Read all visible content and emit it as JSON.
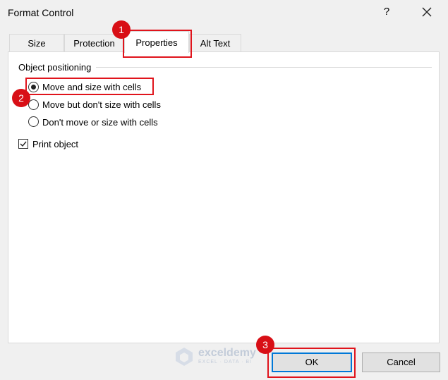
{
  "window": {
    "title": "Format Control",
    "help_glyph": "?",
    "close_icon": "close-x-icon"
  },
  "tabs": [
    {
      "label": "Size",
      "active": false
    },
    {
      "label": "Protection",
      "active": false
    },
    {
      "label": "Properties",
      "active": true
    },
    {
      "label": "Alt Text",
      "active": false
    }
  ],
  "object_positioning": {
    "heading": "Object positioning",
    "options": [
      {
        "label": "Move and size with cells",
        "selected": true
      },
      {
        "label": "Move but don't size with cells",
        "selected": false
      },
      {
        "label": "Don't move or size with cells",
        "selected": false
      }
    ]
  },
  "print_object": {
    "label": "Print object",
    "checked": true
  },
  "buttons": {
    "ok": "OK",
    "cancel": "Cancel"
  },
  "annotations": {
    "step1": "1",
    "step2": "2",
    "step3": "3",
    "highlight_color": "#e0141c"
  },
  "watermark": {
    "name": "exceldemy",
    "tagline": "EXCEL · DATA · BI"
  }
}
